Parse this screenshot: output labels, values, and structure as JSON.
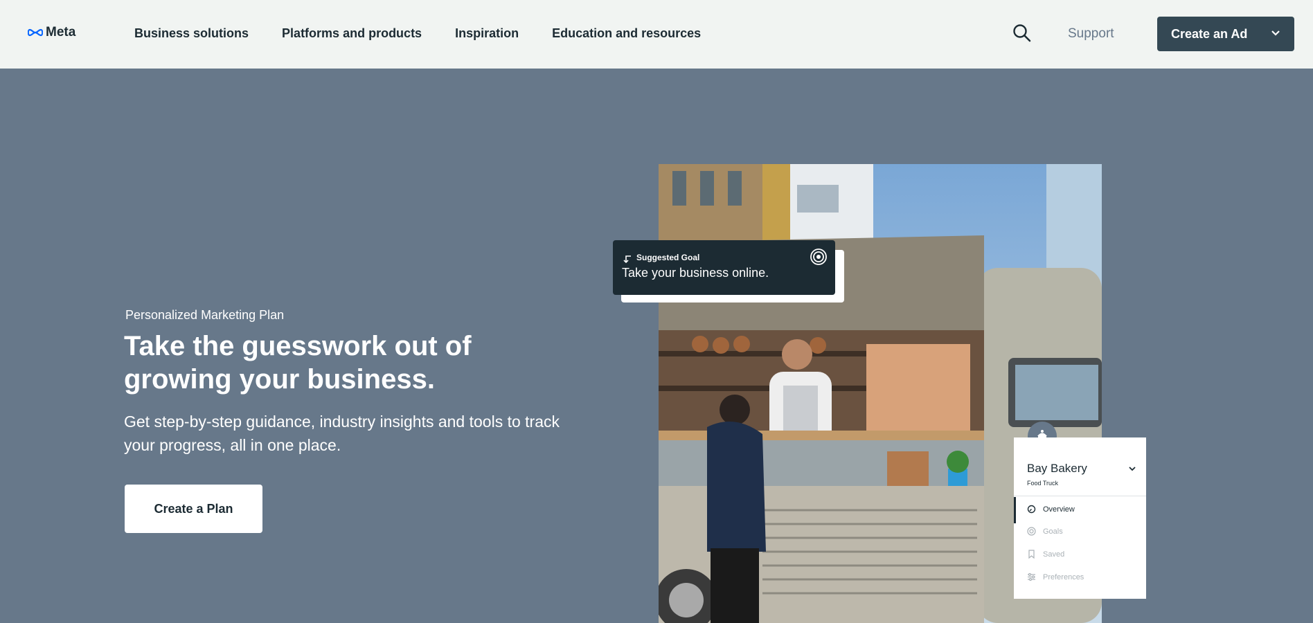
{
  "header": {
    "logo_text": "Meta",
    "nav": [
      "Business solutions",
      "Platforms and products",
      "Inspiration",
      "Education and resources"
    ],
    "support_label": "Support",
    "cta_label": "Create an Ad"
  },
  "hero": {
    "eyebrow": "Personalized Marketing Plan",
    "title": "Take the guesswork out of growing your business.",
    "subtitle": "Get step-by-step guidance, industry insights and tools to track your progress, all in one place.",
    "button_label": "Create a Plan"
  },
  "goal_card": {
    "label": "Suggested Goal",
    "text": "Take your business online."
  },
  "business_card": {
    "name": "Bay Bakery",
    "type": "Food Truck",
    "menu": [
      {
        "label": "Overview",
        "icon": "overview-icon",
        "active": true
      },
      {
        "label": "Goals",
        "icon": "target-icon",
        "active": false
      },
      {
        "label": "Saved",
        "icon": "bookmark-icon",
        "active": false
      },
      {
        "label": "Preferences",
        "icon": "sliders-icon",
        "active": false
      }
    ]
  },
  "colors": {
    "page_bg": "#67788a",
    "header_bg": "#f1f4f2",
    "cta_bg": "#344854",
    "goal_bg": "#1c2b33",
    "meta_blue": "#0866ff"
  }
}
